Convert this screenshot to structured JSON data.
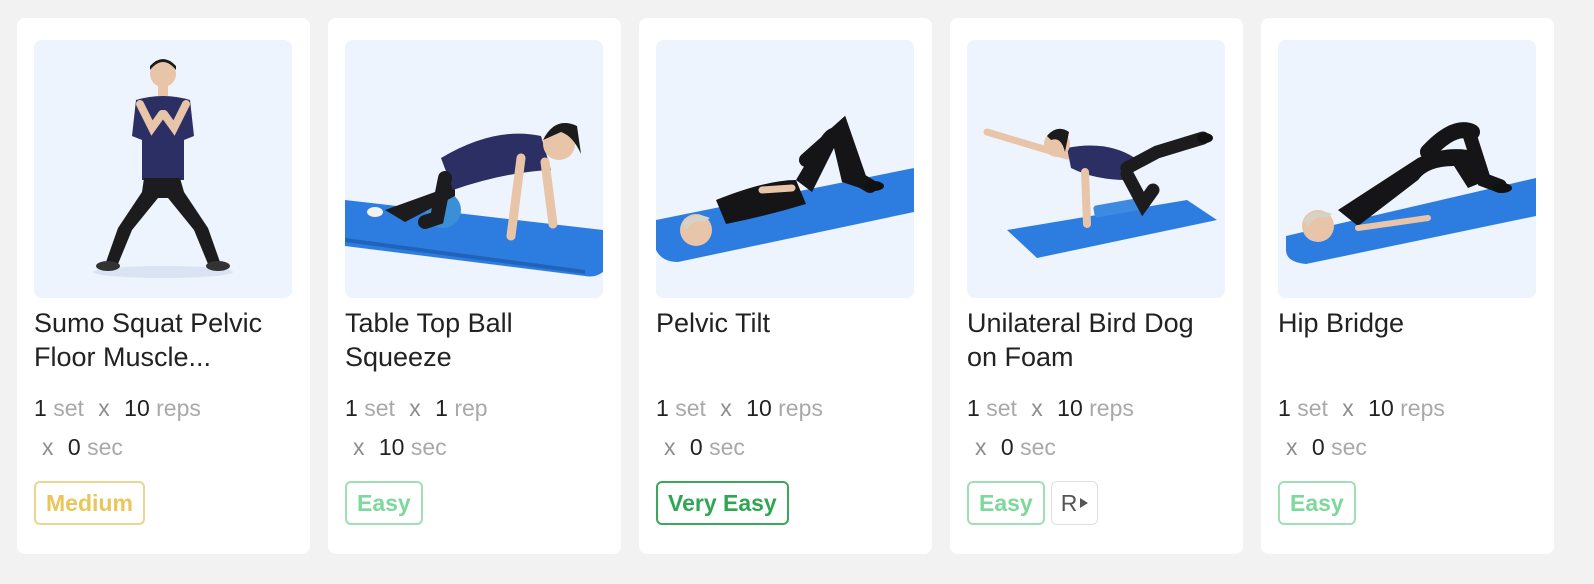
{
  "cards": [
    {
      "title": "Sumo Squat Pelvic Floor Muscle...",
      "sets": "1",
      "sets_unit": "set",
      "reps": "10",
      "reps_unit": "reps",
      "hold": "0",
      "hold_unit": "sec",
      "x": "x",
      "difficulty": "Medium"
    },
    {
      "title": "Table Top Ball Squeeze",
      "sets": "1",
      "sets_unit": "set",
      "reps": "1",
      "reps_unit": "rep",
      "hold": "10",
      "hold_unit": "sec",
      "x": "x",
      "difficulty": "Easy"
    },
    {
      "title": "Pelvic Tilt",
      "sets": "1",
      "sets_unit": "set",
      "reps": "10",
      "reps_unit": "reps",
      "hold": "0",
      "hold_unit": "sec",
      "x": "x",
      "difficulty": "Very Easy"
    },
    {
      "title": "Unilateral Bird Dog on Foam",
      "sets": "1",
      "sets_unit": "set",
      "reps": "10",
      "reps_unit": "reps",
      "hold": "0",
      "hold_unit": "sec",
      "x": "x",
      "difficulty": "Easy",
      "side_tag": "R"
    },
    {
      "title": "Hip Bridge",
      "sets": "1",
      "sets_unit": "set",
      "reps": "10",
      "reps_unit": "reps",
      "hold": "0",
      "hold_unit": "sec",
      "x": "x",
      "difficulty": "Easy"
    }
  ],
  "colors": {
    "medium": "#e8c65a",
    "easy": "#7dd89b",
    "very_easy": "#2fa653",
    "mat": "#2d7de0",
    "shirt": "#2b2f63"
  }
}
